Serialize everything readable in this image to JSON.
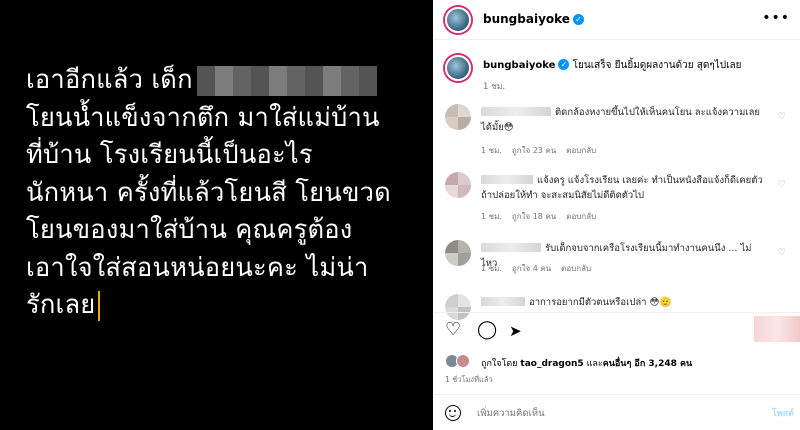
{
  "post_image": {
    "lines": [
      "เอาอีกแล้ว เด็ก",
      "โยนน้ำแข็งจากตึก มาใส่แม่บ้าน",
      "ที่บ้าน โรงเรียนนี้เป็นอะไร",
      "นักหนา ครั้งที่แล้วโยนสี โยนขวด",
      "โยนของมาใส่บ้าน คุณครูต้อง",
      "เอาใจใส่สอนหน่อยนะคะ ไม่น่า",
      "รักเลย"
    ]
  },
  "header": {
    "username": "bungbaiyoke",
    "more": "•••"
  },
  "caption": {
    "username": "bungbaiyoke",
    "text": "โยนเสร็จ ยืนยิ้มดูผลงานด้วย สุดๆไปเลย",
    "time": "1 ชม."
  },
  "comments": [
    {
      "text": "ติดกล้องหงายขึ้นไปให้เห็นคนโยน ละแจ้งความเลยได้มั้ย😳",
      "time": "1 ชม.",
      "likes": "ถูกใจ 23 คน",
      "reply": "ตอบกลับ"
    },
    {
      "text": "แจ้งครู แจ้งโรงเรียน เลยค่ะ ทำเป็นหนังสือแจ้งก็ดีเคยตัวถ้าปล่อยให้ทำ จะสะสมนิสัยไม่ดีติดตัวไป",
      "time": "1 ชม.",
      "likes": "ถูกใจ 18 คน",
      "reply": "ตอบกลับ"
    },
    {
      "text": "รับเด็กจบจากเครือโรงเรียนนี้มาทำงานคนนึง ... ไม่ไหว",
      "time": "1 ชม.",
      "likes": "ถูกใจ 4 คน",
      "reply": "ตอบกลับ"
    },
    {
      "text": "อาการอยากมีตัวตนหรือเปล่า 😳🫡",
      "time": "",
      "likes": "",
      "reply": ""
    }
  ],
  "actions": {
    "like_icon": "heart-icon",
    "comment_icon": "comment-icon",
    "share_icon": "share-icon",
    "save_icon": "bookmark-icon"
  },
  "likes": {
    "prefix": "ถูกใจโดย ",
    "user": "tao_dragon5",
    "middle": " และ",
    "others": "คนอื่นๆ อีก 3,248 คน"
  },
  "post_time": "1 ชั่วโมงที่แล้ว",
  "add_comment": {
    "placeholder": "เพิ่มความคิดเห็น",
    "post_label": "โพสต์"
  },
  "colors": {
    "accent": "#0095f6",
    "story_ring": "#d62976",
    "caret": "#e6b100"
  }
}
